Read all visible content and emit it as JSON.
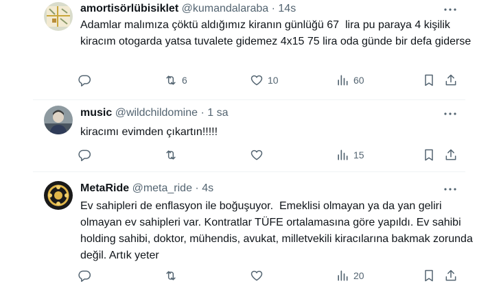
{
  "tweets": [
    {
      "display_name": "amortisörlübisiklet",
      "handle": "@kumandalaraba",
      "separator": "·",
      "time": "14s",
      "text": "Adamlar malımıza çöktü aldığımız kiranın günlüğü 67  lira pu paraya 4 kişilik kiracım otogarda yatsa tuvalete gidemez 4x15 75 lira oda günde bir defa giderse",
      "stats": {
        "replies": "",
        "reposts": "6",
        "likes": "10",
        "views": "60"
      }
    },
    {
      "display_name": "music",
      "handle": "@wildchildomine",
      "separator": "·",
      "time": "1 sa",
      "text": "kiracımı evimden çıkartın!!!!!",
      "stats": {
        "replies": "",
        "reposts": "",
        "likes": "",
        "views": "15"
      }
    },
    {
      "display_name": "MetaRide",
      "handle": "@meta_ride",
      "separator": "·",
      "time": "4s",
      "text": "Ev sahipleri de enflasyon ile boğuşuyor.  Emeklisi olmayan ya da yan geliri olmayan ev sahipleri var. Kontratlar TÜFE ortalamasına göre yapıldı. Ev sahibi holding sahibi, doktor, mühendis, avukat, milletvekili kiracılarına bakmak zorunda değil. Artık yeter",
      "stats": {
        "replies": "",
        "reposts": "",
        "likes": "",
        "views": "20"
      }
    }
  ],
  "colors": {
    "text": "#0f1419",
    "secondary": "#536471",
    "divider": "#eff3f4"
  },
  "icons": [
    "reply-icon",
    "repost-icon",
    "like-icon",
    "views-icon",
    "bookmark-icon",
    "share-icon",
    "more-icon"
  ]
}
